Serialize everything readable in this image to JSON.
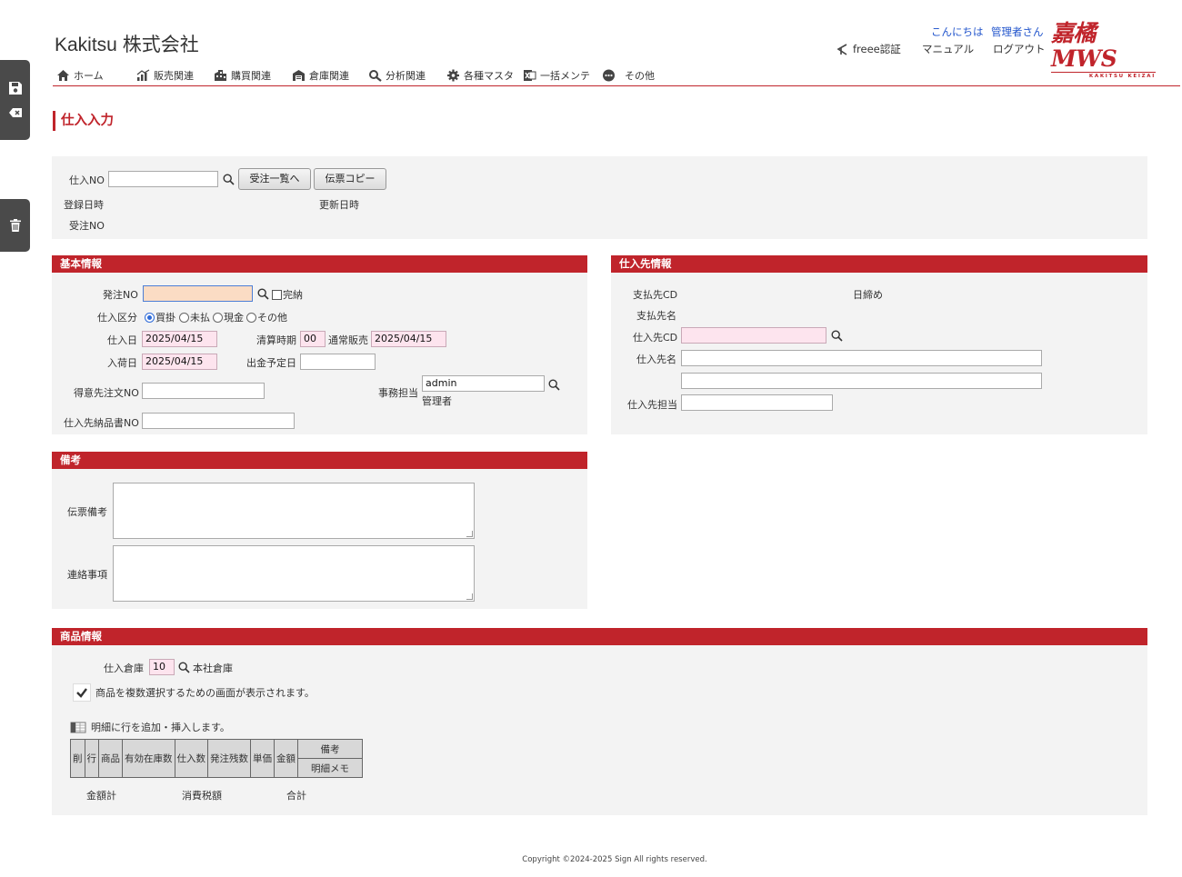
{
  "header": {
    "company": "Kakitsu 株式会社",
    "greeting": "こんにちは",
    "user": "管理者さん",
    "freee_label": "freee認証",
    "manual": "マニュアル",
    "logout": "ログアウト",
    "logo_main": "嘉橘MWS",
    "logo_sub": "KAKITSU KEIZAI"
  },
  "menu": [
    {
      "label": "ホーム",
      "icon": "home-icon"
    },
    {
      "label": "販売関連",
      "icon": "sales-chart-icon"
    },
    {
      "label": "購買関連",
      "icon": "purchase-building-icon"
    },
    {
      "label": "倉庫関連",
      "icon": "warehouse-icon"
    },
    {
      "label": "分析関連",
      "icon": "analysis-tools-icon"
    },
    {
      "label": "各種マスタ",
      "icon": "gear-icon"
    },
    {
      "label": "一括メンテ",
      "icon": "excel-icon"
    },
    {
      "label": "その他",
      "icon": "more-icon"
    }
  ],
  "page_title": "仕入入力",
  "top_form": {
    "shiire_no_label": "仕入NO",
    "shiire_no_value": "",
    "btn_order_list": "受注一覧へ",
    "btn_copy": "伝票コピー",
    "created_label": "登録日時",
    "updated_label": "更新日時",
    "order_no_label": "受注NO"
  },
  "basic": {
    "title": "基本情報",
    "hacchu_no_label": "発注NO",
    "hacchu_no_value": "",
    "kannou_label": "完納",
    "kubun_label": "仕入区分",
    "kubun_options": [
      "買掛",
      "未払",
      "現金",
      "その他"
    ],
    "kubun_selected": "買掛",
    "shiire_date_label": "仕入日",
    "shiire_date_value": "2025/04/15",
    "seisan_label": "清算時期",
    "seisan_value": "00",
    "seisan_link": "通常販売",
    "seisan_date_value": "2025/04/15",
    "nyuka_date_label": "入荷日",
    "nyuka_date_value": "2025/04/15",
    "shukkin_label": "出金予定日",
    "shukkin_value": "",
    "tokui_no_label": "得意先注文NO",
    "tokui_no_value": "",
    "jimu_label": "事務担当",
    "jimu_value": "admin",
    "jimu_link": "管理者",
    "nouhin_label": "仕入先納品書NO",
    "nouhin_value": ""
  },
  "supplier": {
    "title": "仕入先情報",
    "shiharai_cd_label": "支払先CD",
    "shimebi_label": "日締め",
    "shiharai_name_label": "支払先名",
    "shiire_cd_label": "仕入先CD",
    "shiire_cd_value": "",
    "shiire_name_label": "仕入先名",
    "shiire_name_value": "",
    "shiire_name2_value": "",
    "tanto_label": "仕入先担当",
    "tanto_value": ""
  },
  "remarks": {
    "title": "備考",
    "denpyo_label": "伝票備考",
    "renraku_label": "連絡事項"
  },
  "products": {
    "title": "商品情報",
    "souko_label": "仕入倉庫",
    "souko_value": "10",
    "souko_link": "本社倉庫",
    "multi_select_text": "商品を複数選択するための画面が表示されます。",
    "add_row_text": "明細に行を追加・挿入します。",
    "columns": [
      "削",
      "行",
      "商品",
      "有効在庫数",
      "仕入数",
      "発注残数",
      "単価",
      "金額"
    ],
    "col_remarks": "備考",
    "col_memo": "明細メモ",
    "total_label": "金額計",
    "tax_label": "消費税額",
    "sum_label": "合計"
  },
  "footer": "Copyright ©2024-2025 Sign All rights reserved."
}
